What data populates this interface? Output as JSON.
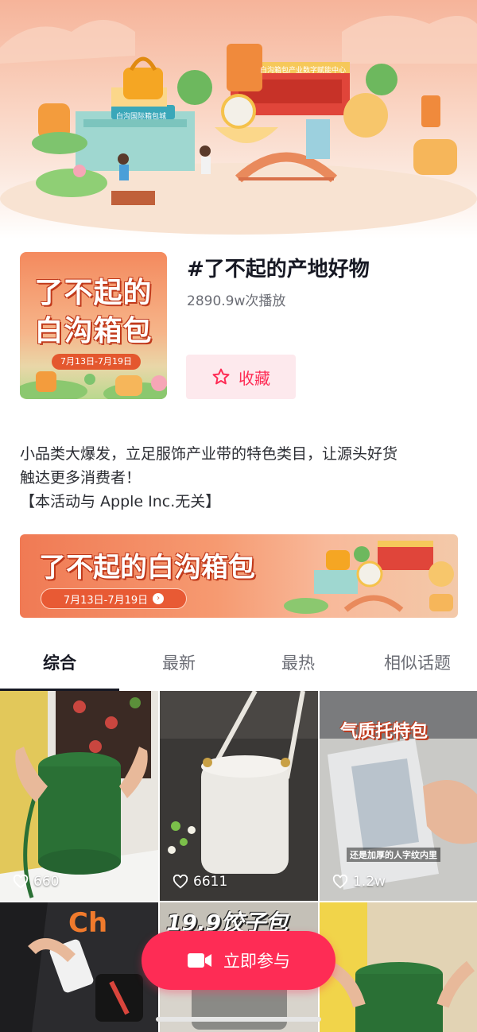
{
  "hero": {
    "sign_mall": "白沟国际箱包城",
    "sign_center": "白沟箱包产业数字赋能中心"
  },
  "topic": {
    "cover_line1": "了不起的",
    "cover_line2": "白沟箱包",
    "cover_date": "7月13日-7月19日",
    "title": "#了不起的产地好物",
    "views": "2890.9w次播放",
    "favorite_label": "收藏"
  },
  "description": {
    "line1": "小品类大爆发，立足服饰产业带的特色类目，让源头好货",
    "line2": "触达更多消费者！",
    "line3": "【本活动与 Apple Inc.无关】"
  },
  "banner": {
    "title": "了不起的白沟箱包",
    "date": "7月13日-7月19日"
  },
  "tabs": [
    {
      "label": "综合"
    },
    {
      "label": "最新"
    },
    {
      "label": "最热"
    },
    {
      "label": "相似话题"
    }
  ],
  "videos": [
    {
      "likes": "660"
    },
    {
      "likes": "6611"
    },
    {
      "likes": "1.2w",
      "overlay_title": "气质托特包",
      "overlay_caption": "还是加厚的人字纹内里"
    },
    {
      "overlay_title": "Ch"
    },
    {
      "overlay_title": "19.9饺子包"
    },
    {}
  ],
  "join_button": {
    "label": "立即参与"
  },
  "colors": {
    "accent": "#fe2c55",
    "text_primary": "#161823",
    "text_secondary": "#6b6d75"
  }
}
